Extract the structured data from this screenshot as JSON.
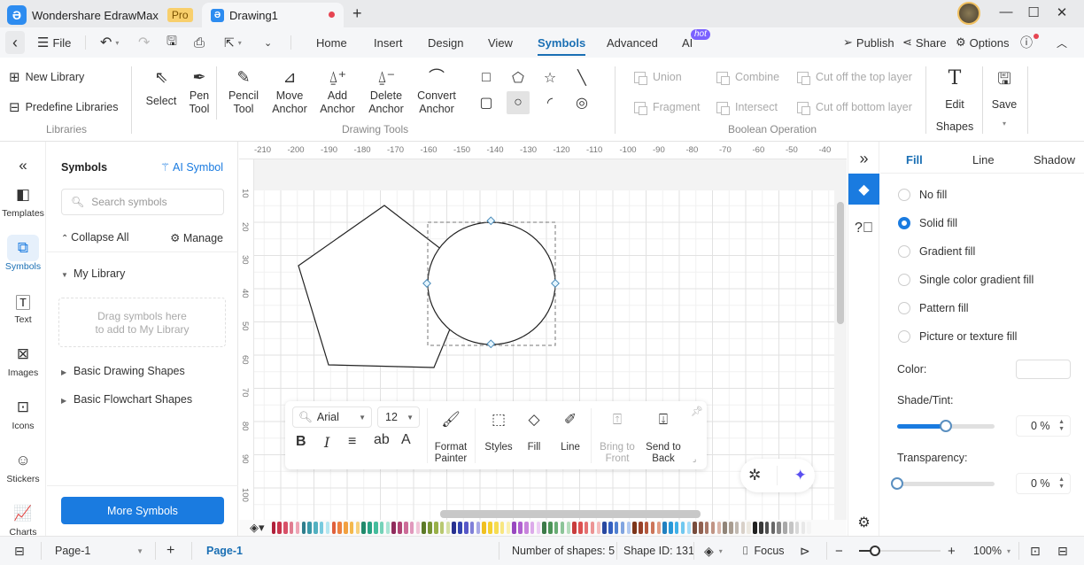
{
  "titlebar": {
    "app_name": "Wondershare EdrawMax",
    "pro_badge": "Pro",
    "doc_tab": "Drawing1",
    "new_tab": "+",
    "minimize": "—",
    "maximize": "☐",
    "close": "✕"
  },
  "menubar": {
    "back": "‹",
    "file": "File",
    "tabs": [
      "Home",
      "Insert",
      "Design",
      "View",
      "Symbols",
      "Advanced",
      "AI"
    ],
    "active_tab": "Symbols",
    "ai_badge": "hot",
    "publish": "Publish",
    "share": "Share",
    "options": "Options"
  },
  "ribbon": {
    "libraries": {
      "new_library": "New Library",
      "predefine_libraries": "Predefine Libraries",
      "group_label": "Libraries"
    },
    "drawing_tools": {
      "select": "Select",
      "pen_tool": [
        "Pen",
        "Tool"
      ],
      "pencil_tool": [
        "Pencil",
        "Tool"
      ],
      "move_anchor": [
        "Move",
        "Anchor"
      ],
      "add_anchor": [
        "Add",
        "Anchor"
      ],
      "delete_anchor": [
        "Delete",
        "Anchor"
      ],
      "convert_anchor": [
        "Convert",
        "Anchor"
      ],
      "group_label": "Drawing Tools",
      "shapes": [
        "rectangle",
        "pentagon",
        "star",
        "line",
        "rounded-rectangle",
        "circle",
        "arc",
        "spiral"
      ],
      "selected_shape": "circle"
    },
    "boolean": {
      "union": "Union",
      "combine": "Combine",
      "cut_top": "Cut off the top layer",
      "fragment": "Fragment",
      "intersect": "Intersect",
      "cut_bottom": "Cut off bottom layer",
      "group_label": "Boolean Operation"
    },
    "edit_shapes": [
      "Edit",
      "Shapes"
    ],
    "save": "Save"
  },
  "rail": {
    "items": [
      {
        "label": "Templates",
        "icon": "templates-icon"
      },
      {
        "label": "Symbols",
        "icon": "symbols-icon"
      },
      {
        "label": "Text",
        "icon": "text-icon"
      },
      {
        "label": "Images",
        "icon": "images-icon"
      },
      {
        "label": "Icons",
        "icon": "icons-icon"
      },
      {
        "label": "Stickers",
        "icon": "stickers-icon"
      },
      {
        "label": "Charts",
        "icon": "charts-icon"
      }
    ],
    "active": "Symbols"
  },
  "symbols_panel": {
    "title": "Symbols",
    "ai_symbol": "AI Symbol",
    "search_placeholder": "Search symbols",
    "collapse_all": "Collapse All",
    "manage": "Manage",
    "my_library": "My Library",
    "drop_hint_1": "Drag symbols here",
    "drop_hint_2": "to add to My Library",
    "libraries": [
      "Basic Drawing Shapes",
      "Basic Flowchart Shapes"
    ],
    "more_symbols": "More Symbols"
  },
  "canvas": {
    "ruler_top": [
      "-210",
      "-200",
      "-190",
      "-180",
      "-170",
      "-160",
      "-150",
      "-140",
      "-130",
      "-120",
      "-110",
      "-100",
      "-90",
      "-80",
      "-70",
      "-60",
      "-50",
      "-40"
    ],
    "ruler_left": [
      "10",
      "20",
      "30",
      "40",
      "50",
      "60",
      "70",
      "80",
      "90",
      "100"
    ],
    "palette_colors": [
      "#b0203a",
      "#c8344c",
      "#d85068",
      "#e07c90",
      "#eea4b4",
      "#2e7e8c",
      "#3a98a8",
      "#52b0c0",
      "#78cade",
      "#b4e6f0",
      "#e0603c",
      "#ec8040",
      "#f2a040",
      "#f4b84c",
      "#f6d07c",
      "#208a6c",
      "#28a284",
      "#44bc9c",
      "#74d2b8",
      "#a8e4d4",
      "#902c5c",
      "#b04474",
      "#cc6c98",
      "#e098bc",
      "#f0c4d8",
      "#5c7a28",
      "#789434",
      "#98b048",
      "#b8c870",
      "#d6e0a4",
      "#283090",
      "#3444b0",
      "#5858c8",
      "#8080d8",
      "#a8a8e6",
      "#f0c020",
      "#f4d030",
      "#f6dc50",
      "#f8e680",
      "#faf0b0",
      "#9848c0",
      "#b060d0",
      "#c884dc",
      "#dcaaea",
      "#ecccf4",
      "#3c7a48",
      "#4c9458",
      "#68ac74",
      "#8cc498",
      "#b4dcbc",
      "#c83c3c",
      "#dc5050",
      "#e47070",
      "#ec9494",
      "#f4bcbc",
      "#2848a0",
      "#3460c0",
      "#5080d0",
      "#80a4e0",
      "#b0c8f0",
      "#7c3418",
      "#984028",
      "#b4583c",
      "#cc7458",
      "#e09c84",
      "#2080c0",
      "#2898d8",
      "#40b0e8",
      "#70c8f0",
      "#a4dcf8",
      "#784c3c",
      "#906050",
      "#a87868",
      "#c09484",
      "#d8b4a8",
      "#908478",
      "#a89c90",
      "#c0b8b0",
      "#d8d0c8",
      "#ece8e0",
      "#202020",
      "#383838",
      "#505050",
      "#686868",
      "#888888",
      "#a8a8a8",
      "#c4c4c4",
      "#d8d8d8",
      "#e8e8e8",
      "#f4f4f4"
    ]
  },
  "float_toolbar": {
    "font": "Arial",
    "size": "12",
    "format_painter": [
      "Format",
      "Painter"
    ],
    "styles": "Styles",
    "fill": "Fill",
    "line": "Line",
    "bring_to_front": [
      "Bring to",
      "Front"
    ],
    "send_to_back": [
      "Send to",
      "Back"
    ]
  },
  "right_panel": {
    "tabs": [
      "Fill",
      "Line",
      "Shadow"
    ],
    "active_tab": "Fill",
    "fill_options": [
      "No fill",
      "Solid fill",
      "Gradient fill",
      "Single color gradient fill",
      "Pattern fill",
      "Picture or texture fill"
    ],
    "selected_fill": "Solid fill",
    "color_label": "Color:",
    "color_value": "#ffffff",
    "shade_label": "Shade/Tint:",
    "shade_value": "0 %",
    "shade_slider": 0.5,
    "transparency_label": "Transparency:",
    "transparency_value": "0 %",
    "transparency_slider": 0
  },
  "statusbar": {
    "page_select": "Page-1",
    "page_tab": "Page-1",
    "num_shapes": "Number of shapes: 5",
    "shape_id": "Shape ID: 131",
    "focus": "Focus",
    "zoom": "100%"
  },
  "colors": {
    "accent": "#1a7be0",
    "active_tab": "#1a6fb4"
  }
}
